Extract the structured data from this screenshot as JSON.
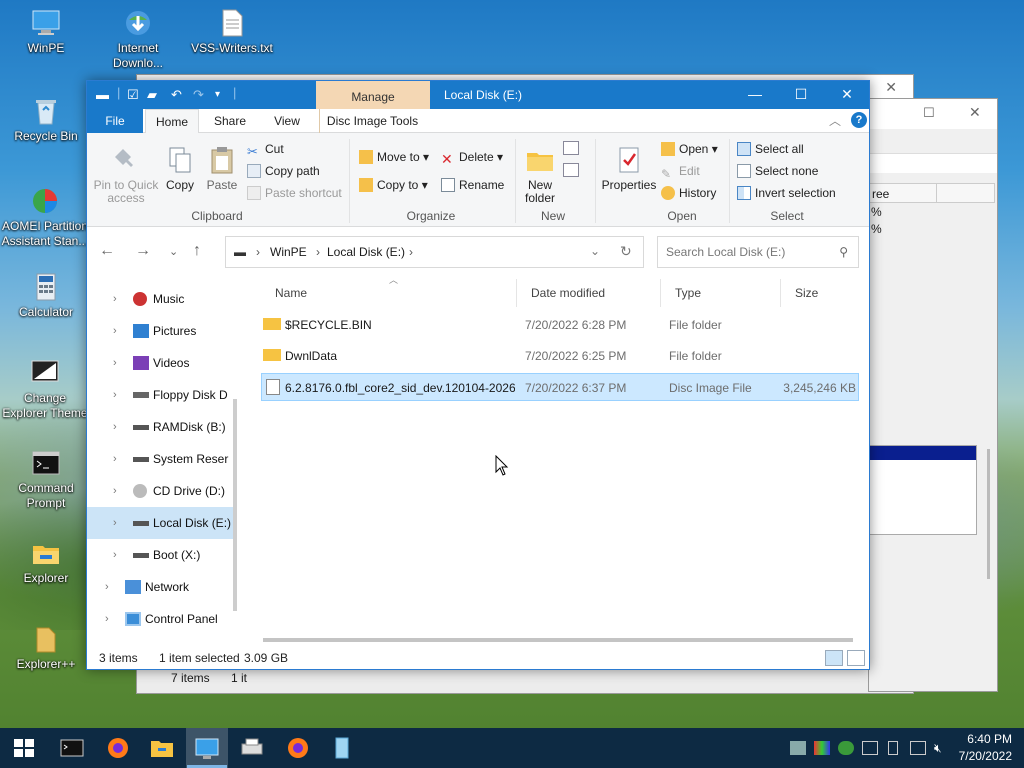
{
  "desktop": {
    "icons": [
      {
        "label": "WinPE",
        "icon": "monitor-icon"
      },
      {
        "label": "Internet Downlo...",
        "icon": "internet-download-manager-icon"
      },
      {
        "label": "VSS-Writers.txt",
        "icon": "text-file-icon"
      },
      {
        "label": "Recycle Bin",
        "icon": "recycle-bin-icon"
      },
      {
        "label": "AOMEI Partition Assistant Stan...",
        "icon": "aomei-partition-icon"
      },
      {
        "label": "Calculator",
        "icon": "calculator-icon"
      },
      {
        "label": "Change Explorer Theme",
        "icon": "change-theme-icon"
      },
      {
        "label": "Command Prompt",
        "icon": "command-prompt-icon"
      },
      {
        "label": "Explorer",
        "icon": "explorer-folder-icon"
      },
      {
        "label": "Explorer++",
        "icon": "explorer-plus-icon"
      }
    ]
  },
  "background_window": {
    "column_header": "ree",
    "cells": [
      "%",
      "%"
    ],
    "status_items": "7 items",
    "status_trunc": "1 it"
  },
  "window": {
    "title": "Local Disk (E:)",
    "context_tab": "Manage",
    "tabs": {
      "file": "File",
      "home": "Home",
      "share": "Share",
      "view": "View",
      "disc_tools": "Disc Image Tools"
    },
    "ribbon": {
      "clipboard": {
        "label": "Clipboard",
        "pin": "Pin to Quick access",
        "copy": "Copy",
        "paste": "Paste",
        "cut": "Cut",
        "copy_path": "Copy path",
        "paste_shortcut": "Paste shortcut"
      },
      "organize": {
        "label": "Organize",
        "move_to": "Move to",
        "copy_to": "Copy to",
        "delete": "Delete",
        "rename": "Rename"
      },
      "new": {
        "label": "New",
        "new_folder": "New folder"
      },
      "open": {
        "label": "Open",
        "properties": "Properties",
        "open": "Open",
        "edit": "Edit",
        "history": "History"
      },
      "select": {
        "label": "Select",
        "select_all": "Select all",
        "select_none": "Select none",
        "invert": "Invert selection"
      }
    },
    "address": {
      "crumbs": [
        "WinPE",
        "Local Disk (E:)"
      ],
      "search_placeholder": "Search Local Disk (E:)"
    },
    "nav_items": [
      {
        "label": "Music",
        "icon": "music-icon"
      },
      {
        "label": "Pictures",
        "icon": "pictures-icon"
      },
      {
        "label": "Videos",
        "icon": "videos-icon"
      },
      {
        "label": "Floppy Disk D",
        "icon": "floppy-drive-icon"
      },
      {
        "label": "RAMDisk (B:)",
        "icon": "drive-icon"
      },
      {
        "label": "System Reser",
        "icon": "drive-icon"
      },
      {
        "label": "CD Drive (D:)",
        "icon": "cd-drive-icon"
      },
      {
        "label": "Local Disk (E:)",
        "icon": "drive-icon"
      },
      {
        "label": "Boot (X:)",
        "icon": "drive-icon"
      },
      {
        "label": "Network",
        "icon": "network-icon"
      },
      {
        "label": "Control Panel",
        "icon": "control-panel-icon"
      }
    ],
    "columns": {
      "name": "Name",
      "date": "Date modified",
      "type": "Type",
      "size": "Size"
    },
    "files": [
      {
        "name": "$RECYCLE.BIN",
        "date": "7/20/2022 6:28 PM",
        "type": "File folder",
        "size": "",
        "icon": "folder-icon"
      },
      {
        "name": "DwnlData",
        "date": "7/20/2022 6:25 PM",
        "type": "File folder",
        "size": "",
        "icon": "folder-icon"
      },
      {
        "name": "6.2.8176.0.fbl_core2_sid_dev.120104-2026...",
        "date": "7/20/2022 6:37 PM",
        "type": "Disc Image File",
        "size": "3,245,246 KB",
        "icon": "disc-image-icon"
      }
    ],
    "status": {
      "count": "3 items",
      "selected": "1 item selected",
      "size": "3.09 GB"
    }
  },
  "taskbar": {
    "time": "6:40 PM",
    "date": "7/20/2022",
    "apps": [
      "start-icon",
      "command-prompt-icon",
      "firefox-icon",
      "file-explorer-icon",
      "desktop-window-icon",
      "printer-icon",
      "firefox-icon",
      "notepad-icon"
    ]
  },
  "colors": {
    "accent": "#1979ca",
    "selection": "#cce8ff",
    "manage_tab": "#f4d7b4",
    "taskbar": "#0d2a43"
  }
}
